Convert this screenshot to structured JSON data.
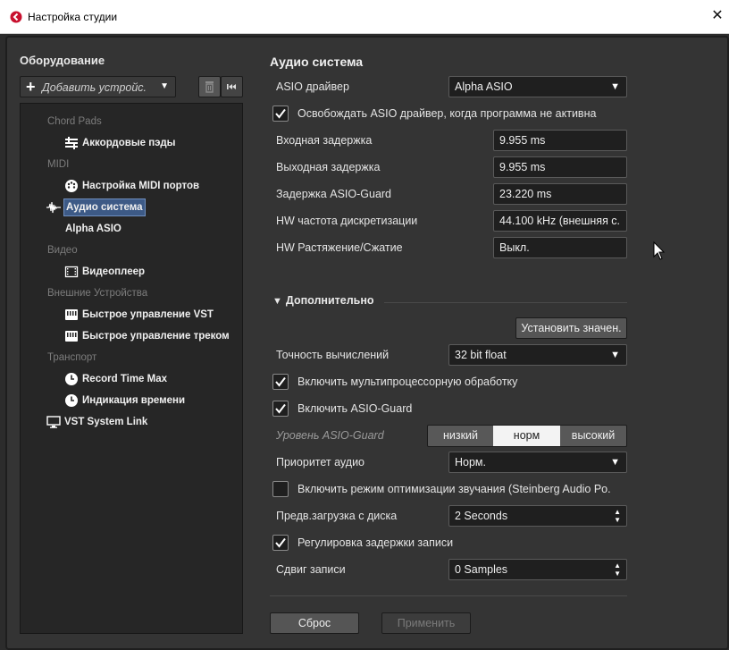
{
  "window": {
    "title": "Настройка студии",
    "close_icon": "close-icon"
  },
  "left": {
    "title": "Оборудование",
    "add_device_label": "Добавить устройс.",
    "tree": [
      {
        "type": "category",
        "label": "Chord Pads"
      },
      {
        "type": "item",
        "label": "Аккордовые пэды",
        "icon": "chord-pads-icon"
      },
      {
        "type": "category",
        "label": "MIDI"
      },
      {
        "type": "item",
        "label": "Настройка MIDI портов",
        "icon": "midi-port-icon"
      },
      {
        "type": "item",
        "label": "Аудио система",
        "icon": "audio-wave-icon",
        "selected": true
      },
      {
        "type": "item",
        "label": "Alpha ASIO",
        "icon": ""
      },
      {
        "type": "category",
        "label": "Видео"
      },
      {
        "type": "item",
        "label": "Видеоплеер",
        "icon": "video-player-icon"
      },
      {
        "type": "category",
        "label": "Внешние Устройства"
      },
      {
        "type": "item",
        "label": "Быстрое управление VST",
        "icon": "quick-controls-icon"
      },
      {
        "type": "item",
        "label": "Быстрое управление треком",
        "icon": "quick-controls-icon"
      },
      {
        "type": "category",
        "label": "Транспорт"
      },
      {
        "type": "item",
        "label": "Record Time Max",
        "icon": "clock-icon"
      },
      {
        "type": "item",
        "label": "Индикация времени",
        "icon": "clock-icon"
      },
      {
        "type": "item",
        "label": "VST System Link",
        "icon": "monitor-icon"
      }
    ]
  },
  "main": {
    "title": "Аудио система",
    "asio_driver_label": "ASIO драйвер",
    "asio_driver_value": "Alpha ASIO",
    "release_driver_label": "Освобождать ASIO драйвер, когда программа не активна",
    "input_latency_label": "Входная задержка",
    "input_latency_value": "9.955 ms",
    "output_latency_label": "Выходная задержка",
    "output_latency_value": "9.955 ms",
    "asio_guard_latency_label": "Задержка ASIO-Guard",
    "asio_guard_latency_value": "23.220 ms",
    "hw_sample_rate_label": "HW частота дискретизации",
    "hw_sample_rate_value": "44.100 kHz (внешняя с.",
    "hw_pullup_label": "HW Растяжение/Сжатие",
    "hw_pullup_value": "Выкл.",
    "advanced_label": "Дополнительно",
    "set_defaults_label": "Установить значен.",
    "precision_label": "Точность вычислений",
    "precision_value": "32 bit float",
    "multiprocessing_label": "Включить мультипроцессорную обработку",
    "asio_guard_enable_label": "Включить ASIO-Guard",
    "asio_guard_level_label": "Уровень ASIO-Guard",
    "asio_guard_levels": [
      "низкий",
      "норм",
      "высокий"
    ],
    "audio_priority_label": "Приоритет аудио",
    "audio_priority_value": "Норм.",
    "suspend_mode_label": "Включить режим оптимизации звучания (Steinberg Audio Po.",
    "disk_preload_label": "Предв.загрузка с диска",
    "disk_preload_value": "2 Seconds",
    "record_latency_label": "Регулировка задержки записи",
    "record_shift_label": "Сдвиг записи",
    "record_shift_value": "0 Samples",
    "reset_label": "Сброс",
    "apply_label": "Применить",
    "checks": {
      "release_driver": true,
      "multiprocessing": true,
      "asio_guard": true,
      "suspend_mode": false,
      "record_latency": true
    }
  },
  "colors": {
    "selection": "#3d5a86",
    "background": "#343434",
    "panel": "#262626"
  }
}
